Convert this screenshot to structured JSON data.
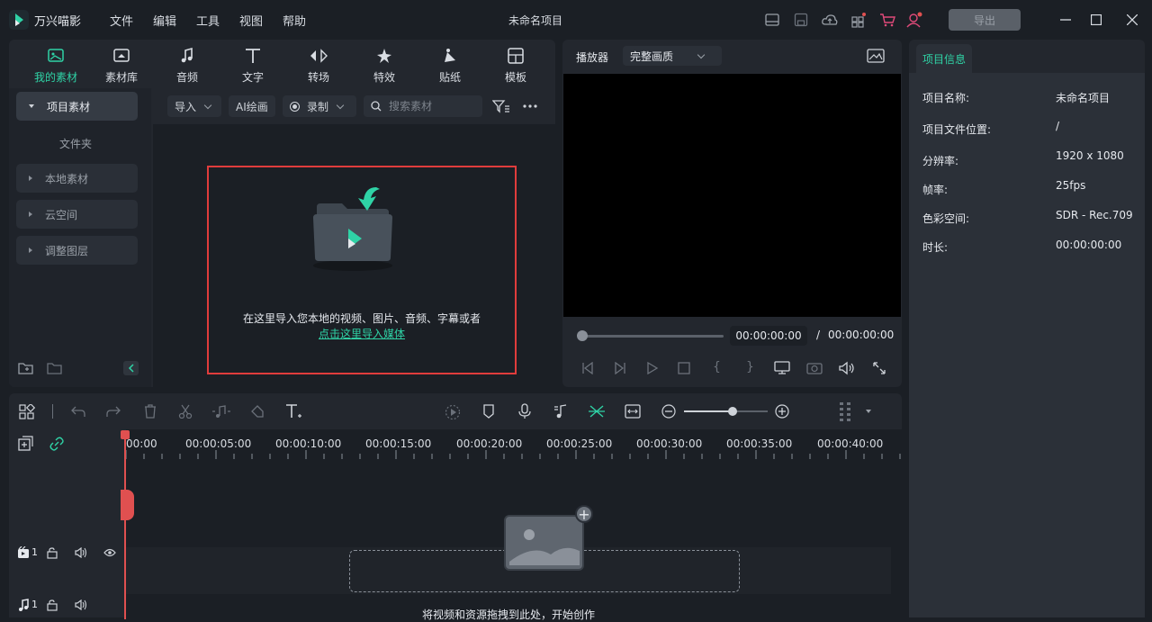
{
  "app": {
    "name": "万兴喵影",
    "document_title": "未命名项目",
    "export_label": "导出"
  },
  "menu": [
    "文件",
    "编辑",
    "工具",
    "视图",
    "帮助"
  ],
  "media_tabs": [
    {
      "label": "我的素材",
      "icon": "my-media-icon",
      "active": true
    },
    {
      "label": "素材库",
      "icon": "stock-library-icon"
    },
    {
      "label": "音频",
      "icon": "music-note-icon"
    },
    {
      "label": "文字",
      "icon": "text-icon"
    },
    {
      "label": "转场",
      "icon": "transition-icon"
    },
    {
      "label": "特效",
      "icon": "effects-icon"
    },
    {
      "label": "贴纸",
      "icon": "sticker-icon"
    },
    {
      "label": "模板",
      "icon": "template-icon"
    }
  ],
  "sidebar": {
    "project_media": "项目素材",
    "folder": "文件夹",
    "items": [
      "本地素材",
      "云空间",
      "调整图层"
    ]
  },
  "media_toolbar": {
    "import": "导入",
    "ai_paint": "AI绘画",
    "record": "录制",
    "search_placeholder": "搜索素材"
  },
  "media_empty": {
    "hint": "在这里导入您本地的视频、图片、音频、字幕或者",
    "link": "点击这里导入媒体"
  },
  "player": {
    "label": "播放器",
    "quality": "完整画质",
    "current_time": "00:00:00:00",
    "separator": "/",
    "total_time": "00:00:00:00"
  },
  "project_info": {
    "tab": "项目信息",
    "rows": [
      {
        "key": "项目名称:",
        "value": "未命名项目"
      },
      {
        "key": "项目文件位置:",
        "value": "/"
      },
      {
        "key": "分辨率:",
        "value": "1920 x 1080"
      },
      {
        "key": "帧率:",
        "value": "25fps"
      },
      {
        "key": "色彩空间:",
        "value": "SDR - Rec.709"
      },
      {
        "key": "时长:",
        "value": "00:00:00:00"
      }
    ]
  },
  "timeline": {
    "ruler": [
      "00:00",
      "00:00:05:00",
      "00:00:10:00",
      "00:00:15:00",
      "00:00:20:00",
      "00:00:25:00",
      "00:00:30:00",
      "00:00:35:00",
      "00:00:40:00"
    ],
    "video_track_number": "1",
    "audio_track_number": "1",
    "drop_hint": "将视频和资源拖拽到此处，开始创作"
  },
  "colors": {
    "accent": "#2fd3a6",
    "highlight_border": "#e03c3c",
    "playhead": "#e05050"
  }
}
